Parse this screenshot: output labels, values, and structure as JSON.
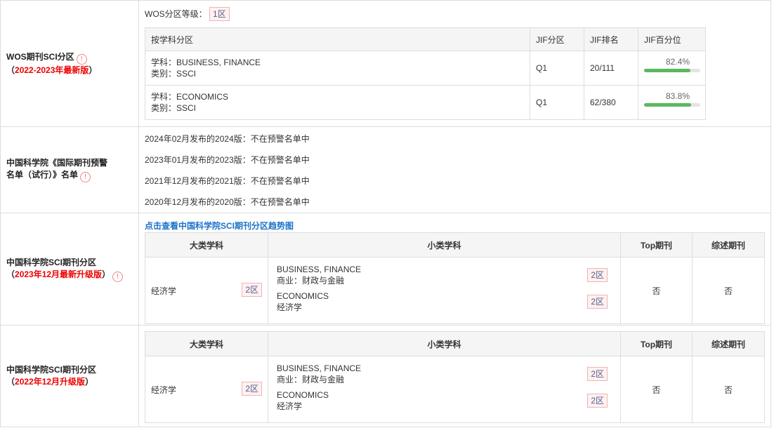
{
  "wos": {
    "label": "WOS期刊SCI分区",
    "edition": "2022-2023年最新版",
    "paren_open": "（",
    "paren_close": "）",
    "level_label": "WOS分区等级：",
    "level": "1区",
    "headers": [
      "按学科分区",
      "JIF分区",
      "JIF排名",
      "JIF百分位"
    ],
    "rows": [
      {
        "subject": "学科：BUSINESS, FINANCE",
        "category": "类别：SSCI",
        "quartile": "Q1",
        "rank": "20/111",
        "percentile": "82.4%",
        "percentile_value": 0.824
      },
      {
        "subject": "学科：ECONOMICS",
        "category": "类别：SSCI",
        "quartile": "Q1",
        "rank": "62/380",
        "percentile": "83.8%",
        "percentile_value": 0.838
      }
    ]
  },
  "warning": {
    "label_line1": "中国科学院《国际期刊预警",
    "label_line2": "名单（试行）》名单",
    "items": [
      "2024年02月发布的2024版：不在预警名单中",
      "2023年01月发布的2023版：不在预警名单中",
      "2021年12月发布的2021版：不在预警名单中",
      "2020年12月发布的2020版：不在预警名单中"
    ]
  },
  "cas2023": {
    "label": "中国科学院SCI期刊分区",
    "edition": "2023年12月最新升级版",
    "trend_link": "点击查看中国科学院SCI期刊分区趋势图",
    "headers": [
      "大类学科",
      "小类学科",
      "Top期刊",
      "综述期刊"
    ],
    "major": "经济学",
    "major_zone": "2区",
    "subs": [
      {
        "en": "BUSINESS, FINANCE",
        "zh": "商业：财政与金融",
        "zone": "2区"
      },
      {
        "en": "ECONOMICS",
        "zh": "经济学",
        "zone": "2区"
      }
    ],
    "top": "否",
    "review": "否"
  },
  "cas2022": {
    "label": "中国科学院SCI期刊分区",
    "edition": "2022年12月升级版",
    "headers": [
      "大类学科",
      "小类学科",
      "Top期刊",
      "综述期刊"
    ],
    "major": "经济学",
    "major_zone": "2区",
    "subs": [
      {
        "en": "BUSINESS, FINANCE",
        "zh": "商业：财政与金融",
        "zone": "2区"
      },
      {
        "en": "ECONOMICS",
        "zh": "经济学",
        "zone": "2区"
      }
    ],
    "top": "否",
    "review": "否"
  },
  "colors": {
    "accent_red": "#e00000",
    "link_blue": "#1a73c9",
    "bar_green": "#5cb85c"
  },
  "icons": {
    "info": "info-circle-icon"
  }
}
